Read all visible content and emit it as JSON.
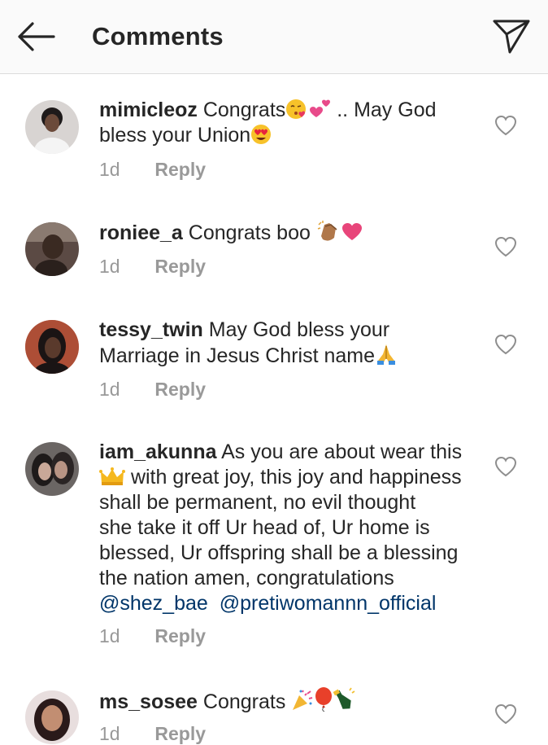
{
  "header": {
    "title": "Comments",
    "back_icon": "arrow-left-icon",
    "share_icon": "paper-plane-icon"
  },
  "colors": {
    "text": "#262626",
    "meta": "#999999",
    "mention": "#003569",
    "header_bg": "#fafafa",
    "border": "#dbdbdb"
  },
  "comments": [
    {
      "username": "mimicleoz",
      "text_1": "Congrats",
      "text_2": ".. May God",
      "text_3": "bless your Union",
      "time": "1d",
      "reply": "Reply",
      "emojis": [
        "face-blowing-kiss",
        "two-hearts",
        "heart-eyes"
      ]
    },
    {
      "username": "roniee_a",
      "text_1": "Congrats boo",
      "time": "1d",
      "reply": "Reply",
      "emojis": [
        "clapping-hands",
        "pink-heart"
      ]
    },
    {
      "username": "tessy_twin",
      "text_1": "May God bless your",
      "text_2": "Marriage in Jesus Christ name",
      "time": "1d",
      "reply": "Reply",
      "emojis": [
        "folded-hands"
      ]
    },
    {
      "username": "iam_akunna",
      "text_1": "As you are about wear this",
      "text_2": "with great joy, this joy and happiness",
      "text_3": "shall be permanent, no evil thought",
      "text_4": "she take it off Ur head of, Ur home is",
      "text_5": "blessed, Ur offspring shall be a blessing",
      "text_6": "the nation amen, congratulations",
      "mention_1": "@shez_bae",
      "mention_2": "@pretiwomannn_official",
      "time": "1d",
      "reply": "Reply",
      "emojis": [
        "crown"
      ]
    },
    {
      "username": "ms_sosee",
      "text_1": "Congrats",
      "time": "1d",
      "reply": "Reply",
      "emojis": [
        "party-popper",
        "balloon",
        "champagne"
      ]
    }
  ]
}
